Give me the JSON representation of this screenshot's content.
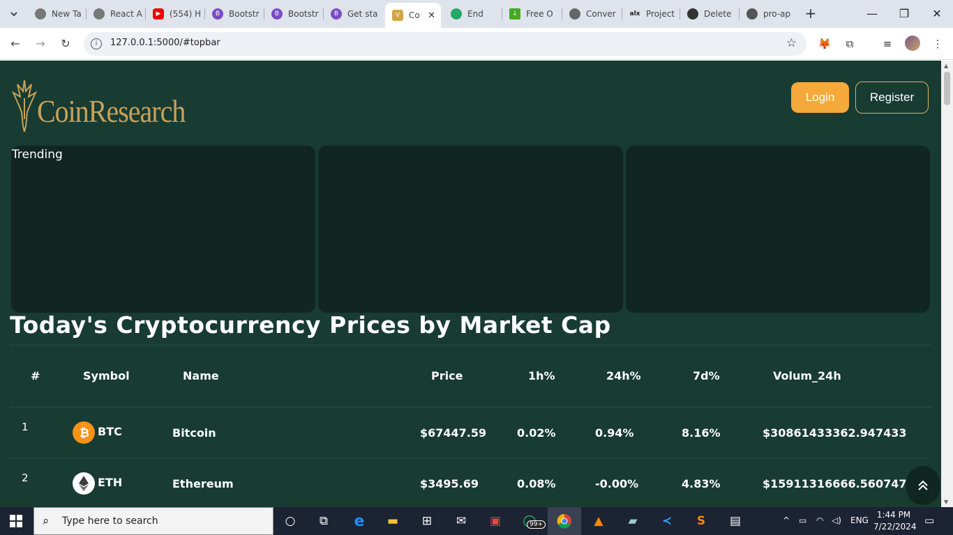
{
  "browser": {
    "tabs": [
      {
        "title": "New Ta",
        "color": "#555"
      },
      {
        "title": "React A",
        "color": "#555"
      },
      {
        "title": "(554) H",
        "color": "#e00"
      },
      {
        "title": "Bootstr",
        "color": "#7b4cc6"
      },
      {
        "title": "Bootstr",
        "color": "#7b4cc6"
      },
      {
        "title": "Get sta",
        "color": "#7b4cc6"
      },
      {
        "title": "Co",
        "color": "#d4a545"
      },
      {
        "title": "End",
        "color": "#2a6"
      },
      {
        "title": "Free O",
        "color": "#4a2"
      },
      {
        "title": "Conver",
        "color": "#666"
      },
      {
        "title": "Project",
        "color": "#222"
      },
      {
        "title": "Delete",
        "color": "#333"
      },
      {
        "title": "pro-ap",
        "color": "#555"
      }
    ],
    "url": "127.0.0.1:5000/#topbar"
  },
  "page": {
    "brand": "CoinResearch",
    "login_label": "Login",
    "register_label": "Register",
    "trending_label": "Trending",
    "section_title": "Today's Cryptocurrency Prices by Market Cap",
    "table": {
      "headers": [
        "#",
        "Symbol",
        "Name",
        "Price",
        "1h%",
        "24h%",
        "7d%",
        "Volum_24h"
      ],
      "rows": [
        {
          "rank": "1",
          "symbol": "BTC",
          "name": "Bitcoin",
          "price": "$67447.59",
          "h1": "0.02%",
          "h24": "0.94%",
          "d7": "8.16%",
          "volume": "$30861433362.947433"
        },
        {
          "rank": "2",
          "symbol": "ETH",
          "name": "Ethereum",
          "price": "$3495.69",
          "h1": "0.08%",
          "h24": "-0.00%",
          "d7": "4.83%",
          "volume": "$15911316666.560747"
        }
      ]
    }
  },
  "taskbar": {
    "search_placeholder": "Type here to search",
    "whatsapp_badge": "99+",
    "language": "ENG",
    "time": "1:44 PM",
    "date": "7/22/2024"
  }
}
